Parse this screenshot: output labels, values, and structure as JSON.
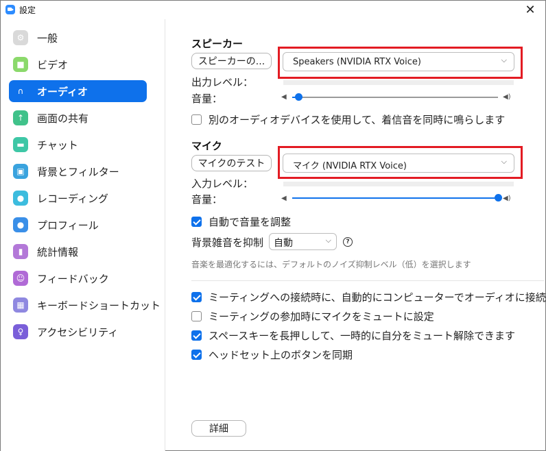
{
  "window": {
    "title": "設定",
    "close_glyph": "✕"
  },
  "sidebar": {
    "items": [
      {
        "label": "一般",
        "icon": "gear-icon",
        "color": "#d9d9d9",
        "glyph": "⚙"
      },
      {
        "label": "ビデオ",
        "icon": "video-icon",
        "color": "#8bd96b",
        "glyph": "■"
      },
      {
        "label": "オーディオ",
        "icon": "headphones-icon",
        "color": "#0e71eb",
        "glyph": "∩",
        "active": true
      },
      {
        "label": "画面の共有",
        "icon": "share-screen-icon",
        "color": "#40c28a",
        "glyph": "↑"
      },
      {
        "label": "チャット",
        "icon": "chat-icon",
        "color": "#3ec7a6",
        "glyph": "▬"
      },
      {
        "label": "背景とフィルター",
        "icon": "background-icon",
        "color": "#3aa3de",
        "glyph": "▣"
      },
      {
        "label": "レコーディング",
        "icon": "recording-icon",
        "color": "#3cbcde",
        "glyph": "●"
      },
      {
        "label": "プロフィール",
        "icon": "profile-icon",
        "color": "#3a8fe8",
        "glyph": "●"
      },
      {
        "label": "統計情報",
        "icon": "statistics-icon",
        "color": "#b378d8",
        "glyph": "▮"
      },
      {
        "label": "フィードバック",
        "icon": "feedback-icon",
        "color": "#b06ad6",
        "glyph": "☺"
      },
      {
        "label": "キーボードショートカット",
        "icon": "keyboard-icon",
        "color": "#8f88e0",
        "glyph": "▦"
      },
      {
        "label": "アクセシビリティ",
        "icon": "accessibility-icon",
        "color": "#7a5fd9",
        "glyph": "♀"
      }
    ]
  },
  "speaker": {
    "title": "スピーカー",
    "test_button": "スピーカーの...",
    "device": "Speakers (NVIDIA RTX Voice)",
    "output_level_label": "出力レベル：",
    "volume_label": "音量：",
    "volume_fraction": 0.03
  },
  "separate_device": {
    "label": "別のオーディオデバイスを使用して、着信音を同時に鳴らします",
    "checked": false
  },
  "mic": {
    "title": "マイク",
    "test_button": "マイクのテスト",
    "device": "マイク (NVIDIA RTX Voice)",
    "input_level_label": "入力レベル：",
    "volume_label": "音量：",
    "volume_fraction": 1.0
  },
  "auto_adjust": {
    "label": "自動で音量を調整",
    "checked": true
  },
  "noise": {
    "label": "背景雑音を抑制",
    "value": "自動",
    "help": "?"
  },
  "noise_hint": "音楽を最適化するには、デフォルトのノイズ抑制レベル（低）を選択します",
  "options": [
    {
      "label": "ミーティングへの接続時に、自動的にコンピューターでオーディオに接続",
      "checked": true
    },
    {
      "label": "ミーティングの参加時にマイクをミュートに設定",
      "checked": false
    },
    {
      "label": "スペースキーを長押しして、一時的に自分をミュート解除できます",
      "checked": true
    },
    {
      "label": "ヘッドセット上のボタンを同期",
      "checked": true
    }
  ],
  "advanced_button": "詳細",
  "colors": {
    "accent": "#0e71eb",
    "highlight": "#e31b23",
    "slider_rest": "#9a9a9a"
  },
  "icons": {
    "chevron": "⌵",
    "speaker_low": "◀",
    "speaker_high": "◀)"
  }
}
